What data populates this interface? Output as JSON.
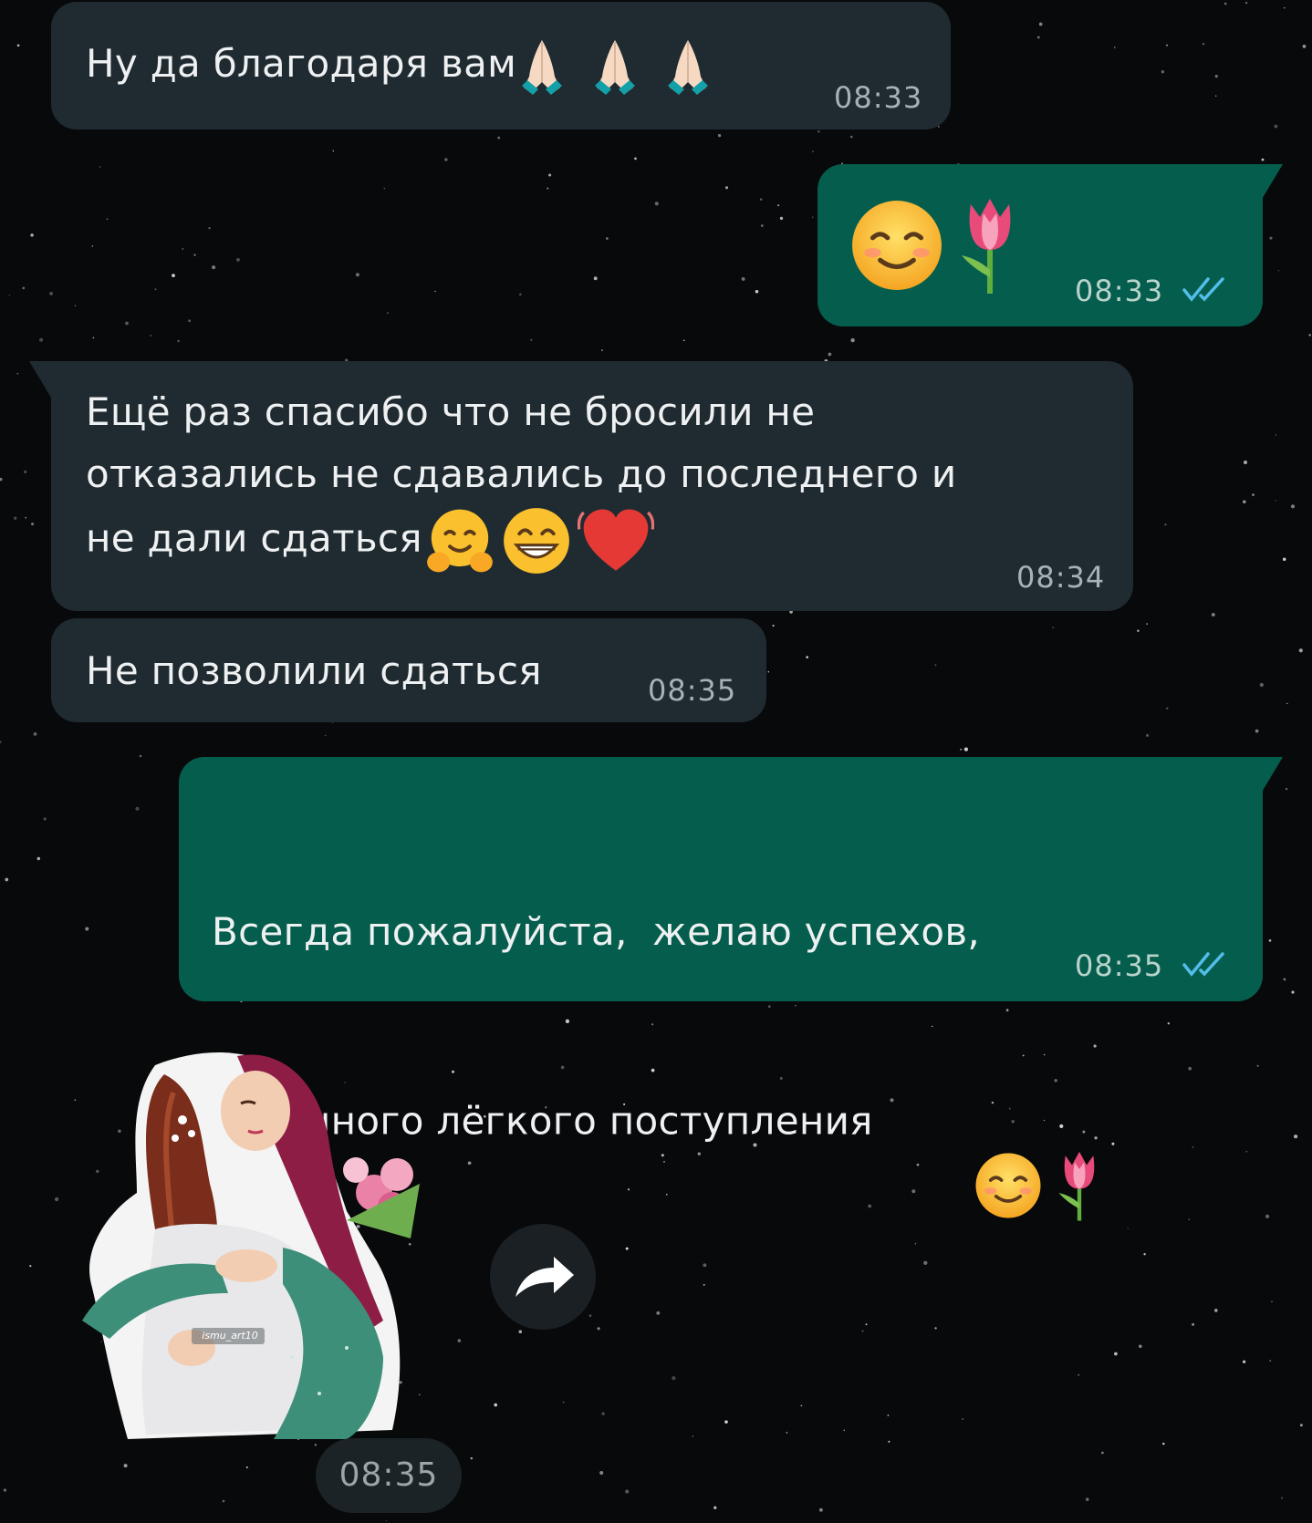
{
  "messages": [
    {
      "direction": "incoming",
      "text": "Ну да благодаря вам",
      "time": "08:33",
      "emoji": [
        "folded-hands",
        "folded-hands",
        "folded-hands"
      ]
    },
    {
      "direction": "outgoing",
      "text": "",
      "time": "08:33",
      "emoji": [
        "smiling-blush",
        "tulip"
      ],
      "status": "read"
    },
    {
      "direction": "incoming",
      "lines": [
        "Ещё раз спасибо что не бросили не",
        "отказались не сдавались до последнего и",
        "не дали сдаться"
      ],
      "time": "08:34",
      "emoji": [
        "hugging-face",
        "grinning-face",
        "beating-heart"
      ]
    },
    {
      "direction": "incoming",
      "text": "Не позволили сдаться",
      "time": "08:35"
    },
    {
      "direction": "outgoing",
      "lines": [
        "Всегда пожалуйста,  желаю успехов,",
        "отличного лёгкого поступления"
      ],
      "time": "08:35",
      "emoji": [
        "smiling-blush",
        "tulip"
      ],
      "status": "read"
    }
  ],
  "sticker": {
    "watermark": "ismu_art10",
    "time": "08:35",
    "description_icon": "two-women-hugging-sticker"
  },
  "colors": {
    "background": "#08090a",
    "incoming_bubble": "#1f2b31",
    "outgoing_bubble": "#055e4d",
    "read_ticks": "#53bdeb"
  },
  "icons": {
    "forward": "forward-arrow-icon",
    "read": "double-check-icon"
  }
}
